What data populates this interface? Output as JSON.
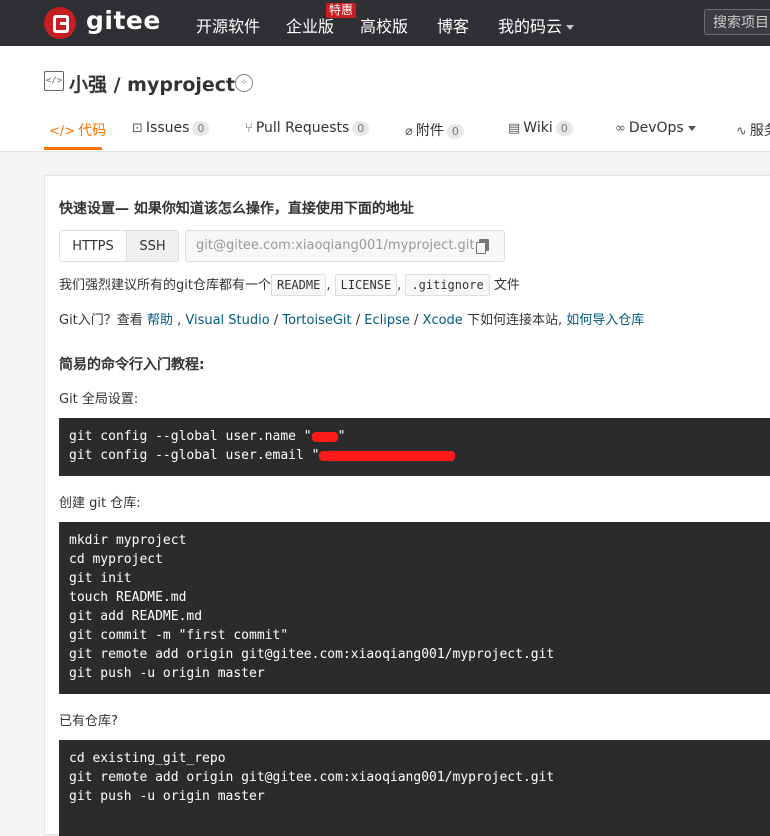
{
  "nav": {
    "logo_text": "gitee",
    "items": [
      {
        "label": "开源软件"
      },
      {
        "label": "企业版"
      },
      {
        "label": "高校版"
      },
      {
        "label": "博客"
      },
      {
        "label": "我的码云"
      }
    ],
    "hot_badge": "特惠",
    "search_placeholder": "搜索项目"
  },
  "repo": {
    "title": "小强 / myproject",
    "tabs": [
      {
        "icon": "code-icon",
        "label": "代码",
        "active": true
      },
      {
        "icon": "issues-icon",
        "label": "Issues",
        "count": "0"
      },
      {
        "icon": "pull-request-icon",
        "label": "Pull Requests",
        "count": "0"
      },
      {
        "icon": "attachment-icon",
        "label": "附件",
        "count": "0"
      },
      {
        "icon": "wiki-icon",
        "label": "Wiki",
        "count": "0"
      },
      {
        "icon": "devops-icon",
        "label": "DevOps"
      },
      {
        "icon": "service-icon",
        "label": "服务"
      }
    ]
  },
  "quick_setup": {
    "title": "快速设置— 如果你知道该怎么操作，直接使用下面的地址",
    "protocols": [
      "HTTPS",
      "SSH"
    ],
    "url": "git@gitee.com:xiaoqiang001/myproject.git",
    "recommend_prefix": "我们强烈建议所有的git仓库都有一个",
    "recommend_files": [
      "README",
      "LICENSE",
      ".gitignore"
    ],
    "recommend_suffix": "文件",
    "help_prefix": "Git入门？查看",
    "help_links": [
      "帮助",
      "Visual Studio",
      "TortoiseGit",
      "Eclipse",
      "Xcode"
    ],
    "help_middle": "下如何连接本站,",
    "help_last_link": "如何导入仓库"
  },
  "tutorial": {
    "title": "简易的命令行入门教程:",
    "global_label": "Git 全局设置:",
    "global_lines": [
      "git config --global user.name \"",
      "git config --global user.email \""
    ],
    "global_line1_suffix": "\"",
    "create_label": "创建 git 仓库:",
    "create_lines": [
      "mkdir myproject",
      "cd myproject",
      "git init",
      "touch README.md",
      "git add README.md",
      "git commit -m \"first commit\"",
      "git remote add origin git@gitee.com:xiaoqiang001/myproject.git",
      "git push -u origin master"
    ],
    "existing_label": "已有仓库?",
    "existing_lines": [
      "cd existing_git_repo",
      "git remote add origin git@gitee.com:xiaoqiang001/myproject.git",
      "git push -u origin master"
    ]
  },
  "colors": {
    "nav_bg": "#2e3033",
    "brand_red": "#c71d23",
    "tab_active": "#fe7300",
    "link": "#005980",
    "code_bg": "#2b2b2b",
    "redaction": "#ff1a1a"
  }
}
